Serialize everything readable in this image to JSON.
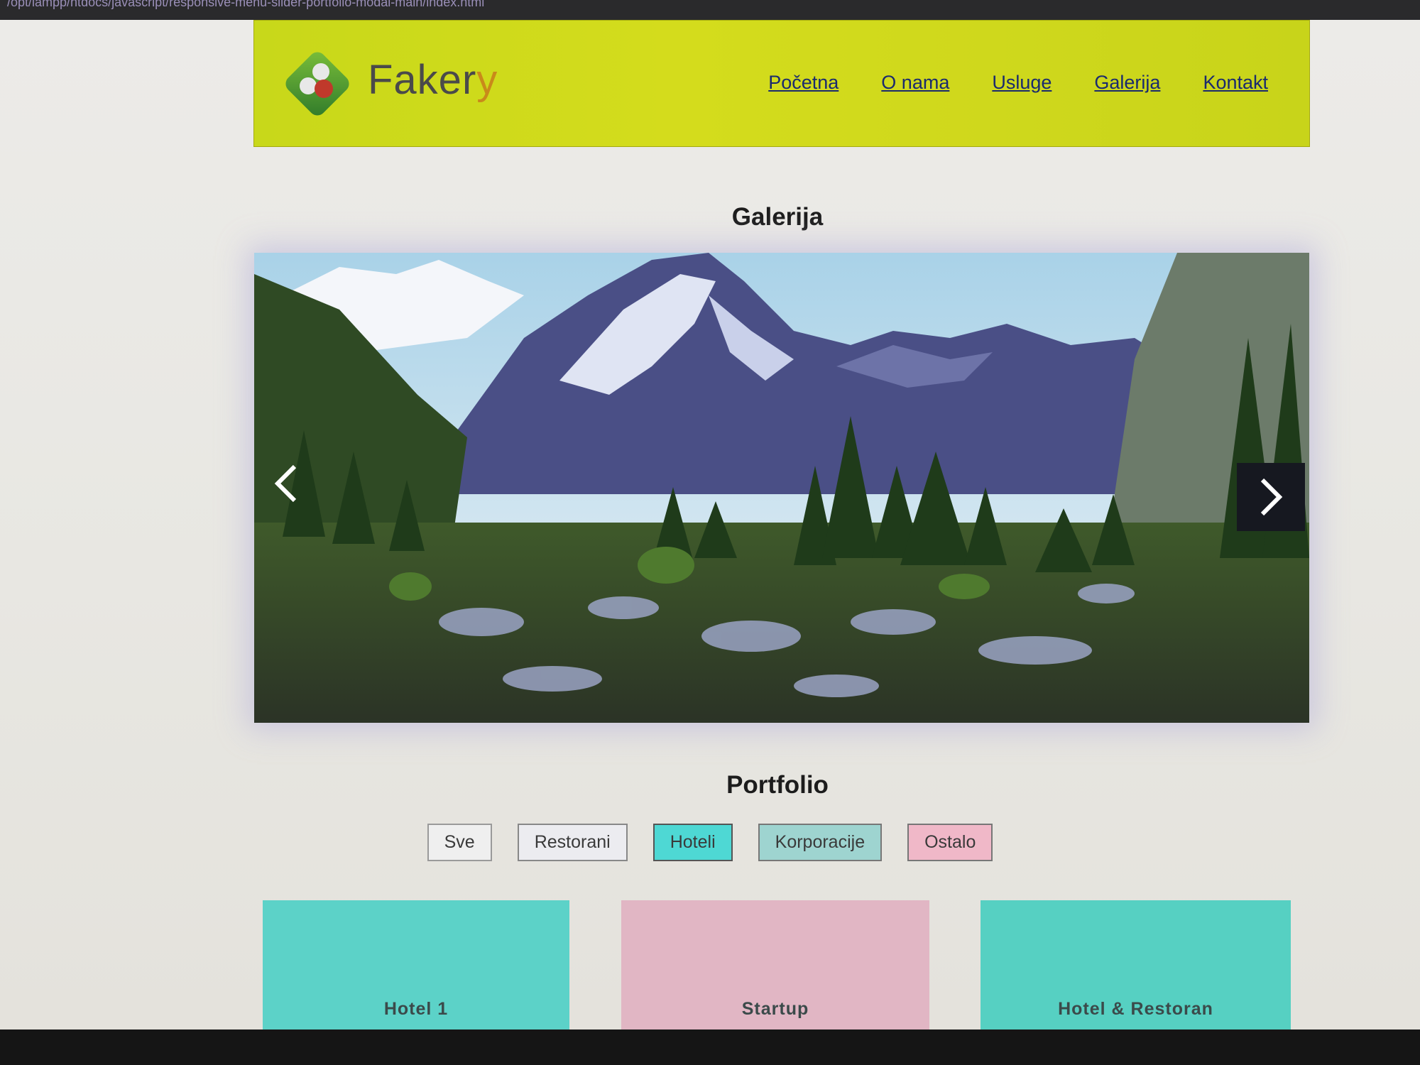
{
  "browser": {
    "path_text": "/opt/lampp/htdocs/javascript/responsive-menu-slider-portfolio-modal-main/index.html"
  },
  "header": {
    "logo_text_main": "Faker",
    "logo_text_accent": "y",
    "nav": [
      {
        "label": "Početna"
      },
      {
        "label": "O nama"
      },
      {
        "label": "Usluge"
      },
      {
        "label": "Galerija"
      },
      {
        "label": "Kontakt"
      }
    ]
  },
  "gallery": {
    "title": "Galerija",
    "prev_icon": "chevron-left-icon",
    "next_icon": "chevron-right-icon"
  },
  "portfolio": {
    "title": "Portfolio",
    "filters": [
      {
        "label": "Sve"
      },
      {
        "label": "Restorani"
      },
      {
        "label": "Hoteli"
      },
      {
        "label": "Korporacije"
      },
      {
        "label": "Ostalo"
      }
    ],
    "cards": [
      {
        "title": "Hotel 1",
        "color": "#5cd2c8"
      },
      {
        "title": "Startup",
        "color": "#e1b6c4"
      },
      {
        "title": "Hotel & Restoran",
        "color": "#56d0c2"
      }
    ]
  },
  "colors": {
    "header_bg": "#cfd81c",
    "nav_link": "#1a2a6e",
    "hoteli_active": "#4ed8d4",
    "ostalo": "#f0b8c8"
  }
}
